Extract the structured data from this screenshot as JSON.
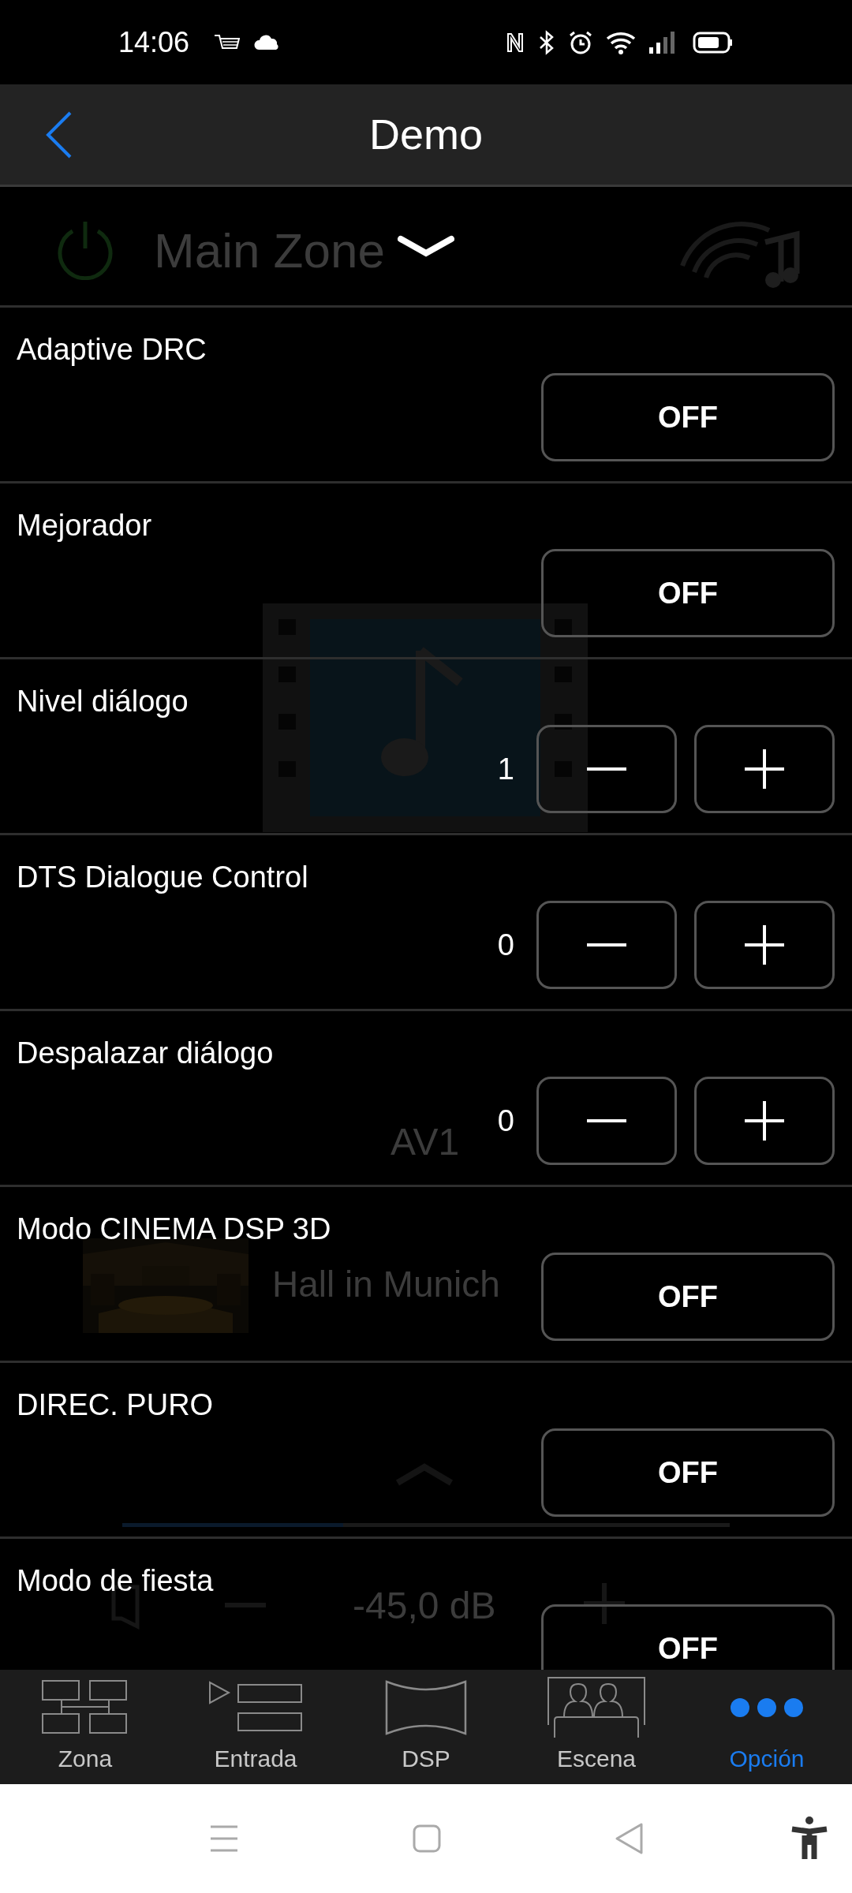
{
  "status_bar": {
    "time": "14:06"
  },
  "header": {
    "title": "Demo"
  },
  "background": {
    "zone": "Main Zone",
    "input": "AV1",
    "program": "Hall in Munich",
    "volume": "-45,0 dB"
  },
  "settings": [
    {
      "kind": "toggle",
      "label": "Adaptive DRC",
      "value": "OFF"
    },
    {
      "kind": "toggle",
      "label": "Mejorador",
      "value": "OFF"
    },
    {
      "kind": "stepper",
      "label": "Nivel diálogo",
      "value": "1"
    },
    {
      "kind": "stepper",
      "label": "DTS Dialogue Control",
      "value": "0"
    },
    {
      "kind": "stepper",
      "label": "Despalazar diálogo",
      "value": "0"
    },
    {
      "kind": "toggle",
      "label": "Modo CINEMA DSP 3D",
      "value": "OFF"
    },
    {
      "kind": "toggle",
      "label": "DIREC. PURO",
      "value": "OFF"
    },
    {
      "kind": "toggle",
      "label": "Modo de fiesta",
      "value": "OFF"
    }
  ],
  "tabs": [
    {
      "kind": "zone",
      "label": "Zona",
      "selected": false
    },
    {
      "kind": "input",
      "label": "Entrada",
      "selected": false
    },
    {
      "kind": "dsp",
      "label": "DSP",
      "selected": false
    },
    {
      "kind": "scene",
      "label": "Escena",
      "selected": false
    },
    {
      "kind": "option",
      "label": "Opción",
      "selected": true
    }
  ]
}
